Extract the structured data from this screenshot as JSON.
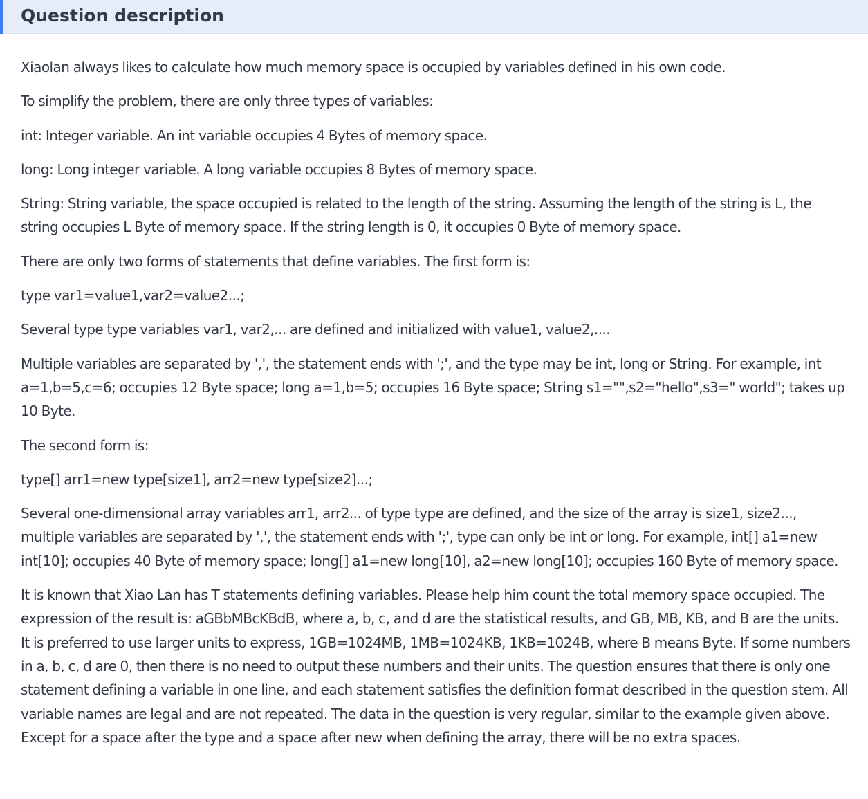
{
  "header": {
    "title": "Question description"
  },
  "paragraphs": [
    "Xiaolan always likes to calculate how much memory space is occupied by variables defined in his own code.",
    "To simplify the problem, there are only three types of variables:",
    "int: Integer variable. An int variable occupies 4 Bytes of memory space.",
    "long: Long integer variable. A long variable occupies 8 Bytes of memory space.",
    "String: String variable, the space occupied is related to the length of the string. Assuming the length of the string is L, the string occupies L Byte of memory space. If the string length is 0, it occupies 0 Byte of memory space.",
    "There are only two forms of statements that define variables. The first form is:",
    "type var1=value1,var2=value2...;",
    "Several type type variables var1, var2,... are defined and initialized with value1, value2,....",
    "Multiple variables are separated by ',', the statement ends with ';', and the type may be int, long or String. For example, int a=1,b=5,c=6; occupies 12 Byte space; long a=1,b=5; occupies 16 Byte space; String s1=\"\",s2=\"hello\",s3=\" world\"; takes up 10 Byte.",
    "The second form is:",
    "type[] arr1=new type[size1], arr2=new type[size2]...;",
    "Several one-dimensional array variables arr1, arr2... of type type are defined, and the size of the array is size1, size2..., multiple variables are separated by ',', the statement ends with ';', type can only be int or long. For example, int[] a1=new int[10]; occupies 40 Byte of memory space; long[] a1=new long[10], a2=new long[10]; occupies 160 Byte of memory space.",
    "It is known that Xiao Lan has T statements defining variables. Please help him count the total memory space occupied. The expression of the result is: aGBbMBcKBdB, where a, b, c, and d are the statistical results, and GB, MB, KB, and B are the units. It is preferred to use larger units to express, 1GB=1024MB, 1MB=1024KB, 1KB=1024B, where B means Byte. If some numbers in a, b, c, d are 0, then there is no need to output these numbers and their units. The question ensures that there is only one statement defining a variable in one line, and each statement satisfies the definition format described in the question stem. All variable names are legal and are not repeated. The data in the question is very regular, similar to the example given above. Except for a space after the type and a space after new when defining the array, there will be no extra spaces."
  ]
}
